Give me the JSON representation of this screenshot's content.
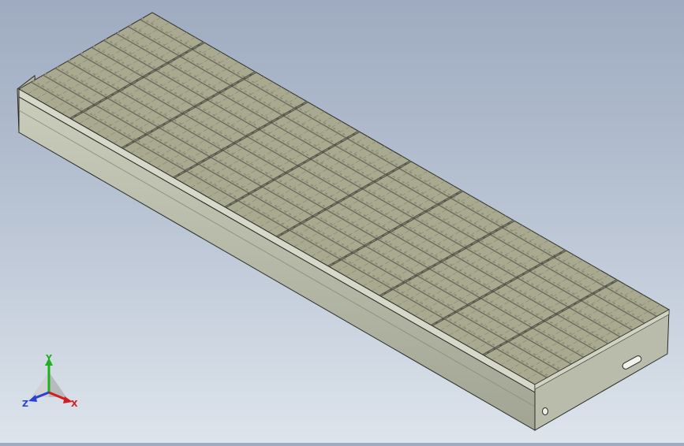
{
  "scene": {
    "colors": {
      "background_top": "#9eabc0",
      "background_bottom": "#dde4ec",
      "grating_fill": "#a8a98f",
      "grating_bar": "#6a6b5e",
      "grating_slot": "#8e8f79",
      "cross_rod": "#56574c",
      "side_plate": "#b6b9a6",
      "side_plate_dark": "#8d9080",
      "end_plate": "#b8bbaa",
      "outline": "#2b2c27"
    },
    "model": "stair-tread-grating"
  },
  "triad": {
    "x_label": "X",
    "y_label": "Y",
    "z_label": "Z",
    "x_color": "#d21e1e",
    "y_color": "#1fb01f",
    "z_color": "#2a3fd4"
  }
}
